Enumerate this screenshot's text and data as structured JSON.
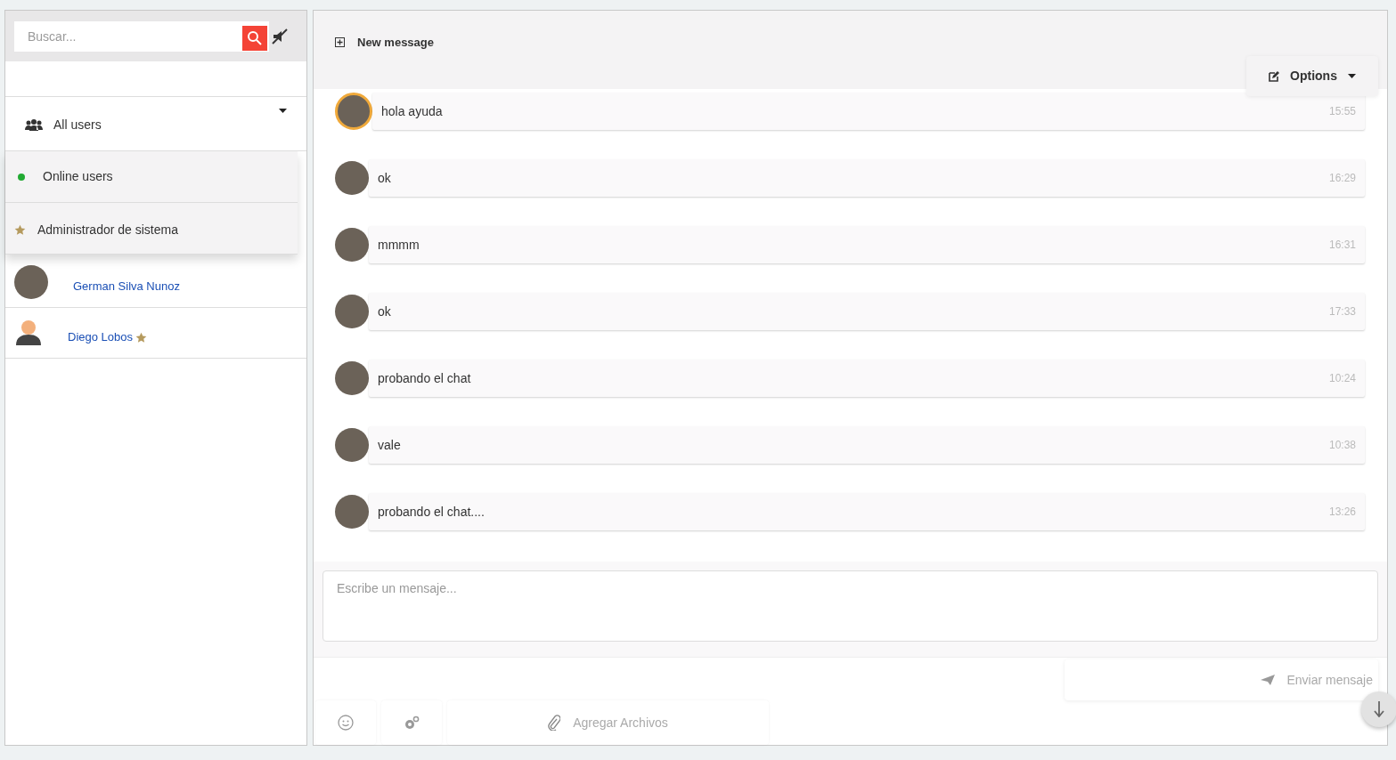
{
  "search": {
    "placeholder": "Buscar..."
  },
  "filter": {
    "label": "All users",
    "expanded": true,
    "options": [
      {
        "kind": "online",
        "label": "Online users",
        "color": "#22aa33"
      },
      {
        "kind": "admin",
        "label": "Administrador de sistema"
      }
    ]
  },
  "users": [
    {
      "name": "German Silva Nunoz",
      "kind": "photo",
      "admin": false
    },
    {
      "name": "Diego Lobos",
      "kind": "default",
      "admin": true
    }
  ],
  "header": {
    "new_message": "New message",
    "options": "Options"
  },
  "messages": [
    {
      "text": "hola ayuda",
      "time": "15:55",
      "kind": "photo",
      "highlighted": true
    },
    {
      "text": "ok",
      "time": "16:29",
      "kind": "photo",
      "highlighted": false
    },
    {
      "text": "mmmm",
      "time": "16:31",
      "kind": "photo",
      "highlighted": false
    },
    {
      "text": "ok",
      "time": "17:33",
      "kind": "photo",
      "highlighted": false
    },
    {
      "text": "probando el chat",
      "time": "10:24",
      "kind": "photo",
      "highlighted": false
    },
    {
      "text": "vale",
      "time": "10:38",
      "kind": "photo",
      "highlighted": false
    },
    {
      "text": "probando el chat....",
      "time": "13:26",
      "kind": "photo",
      "highlighted": false
    }
  ],
  "composer": {
    "placeholder": "Escribe un mensaje...",
    "send": "Enviar mensaje",
    "attach": "Agregar Archivos"
  }
}
